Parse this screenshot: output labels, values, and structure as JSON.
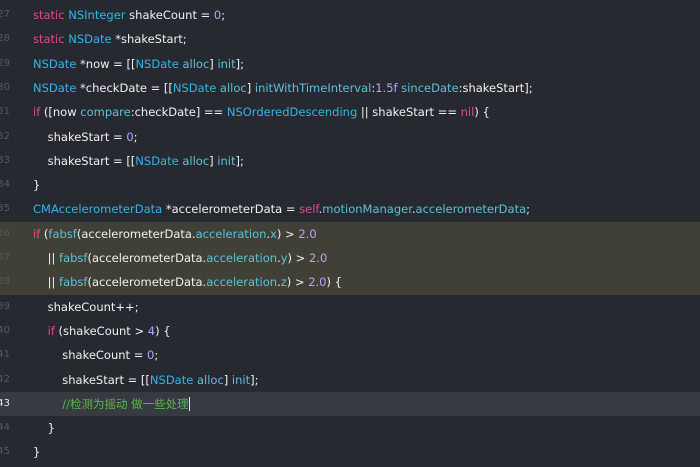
{
  "gutter": [
    "27",
    "28",
    "29",
    "30",
    "31",
    "32",
    "33",
    "34",
    "35",
    "36",
    "37",
    "38",
    "39",
    "40",
    "41",
    "42",
    "43",
    "44",
    "45"
  ],
  "lines": [
    [
      {
        "t": "static",
        "c": "kw"
      },
      {
        "t": " "
      },
      {
        "t": "NSInteger",
        "c": "ty"
      },
      {
        "t": " shakeCount = "
      },
      {
        "t": "0",
        "c": "num"
      },
      {
        "t": ";"
      }
    ],
    [
      {
        "t": "static",
        "c": "kw"
      },
      {
        "t": " "
      },
      {
        "t": "NSDate",
        "c": "ty"
      },
      {
        "t": " *shakeStart;"
      }
    ],
    [
      {
        "t": "NSDate",
        "c": "ty"
      },
      {
        "t": " *now = [["
      },
      {
        "t": "NSDate",
        "c": "ty"
      },
      {
        "t": " "
      },
      {
        "t": "alloc",
        "c": "fn"
      },
      {
        "t": "] "
      },
      {
        "t": "init",
        "c": "fn"
      },
      {
        "t": "];"
      }
    ],
    [
      {
        "t": "NSDate",
        "c": "ty"
      },
      {
        "t": " *checkDate = [["
      },
      {
        "t": "NSDate",
        "c": "ty"
      },
      {
        "t": " "
      },
      {
        "t": "alloc",
        "c": "fn"
      },
      {
        "t": "] "
      },
      {
        "t": "initWithTimeInterval",
        "c": "fn"
      },
      {
        "t": ":"
      },
      {
        "t": "1.5f",
        "c": "num"
      },
      {
        "t": " "
      },
      {
        "t": "sinceDate",
        "c": "fn"
      },
      {
        "t": ":shakeStart];"
      }
    ],
    [
      {
        "t": "if",
        "c": "kw"
      },
      {
        "t": " ([now "
      },
      {
        "t": "compare",
        "c": "fn"
      },
      {
        "t": ":checkDate] == "
      },
      {
        "t": "NSOrderedDescending",
        "c": "ty"
      },
      {
        "t": " || shakeStart == "
      },
      {
        "t": "nil",
        "c": "kw"
      },
      {
        "t": ") {"
      }
    ],
    [
      {
        "t": "    shakeStart = "
      },
      {
        "t": "0",
        "c": "num"
      },
      {
        "t": ";"
      }
    ],
    [
      {
        "t": "    shakeStart = [["
      },
      {
        "t": "NSDate",
        "c": "ty"
      },
      {
        "t": " "
      },
      {
        "t": "alloc",
        "c": "fn"
      },
      {
        "t": "] "
      },
      {
        "t": "init",
        "c": "fn"
      },
      {
        "t": "];"
      }
    ],
    [
      {
        "t": "}"
      }
    ],
    [
      {
        "t": "CMAccelerometerData",
        "c": "ty"
      },
      {
        "t": " *accelerometerData = "
      },
      {
        "t": "self",
        "c": "kw"
      },
      {
        "t": "."
      },
      {
        "t": "motionManager",
        "c": "fn"
      },
      {
        "t": "."
      },
      {
        "t": "accelerometerData",
        "c": "fn"
      },
      {
        "t": ";"
      }
    ],
    [
      {
        "t": "if",
        "c": "kw"
      },
      {
        "t": " ("
      },
      {
        "t": "fabsf",
        "c": "fn"
      },
      {
        "t": "(accelerometerData."
      },
      {
        "t": "acceleration",
        "c": "fn"
      },
      {
        "t": "."
      },
      {
        "t": "x",
        "c": "fn"
      },
      {
        "t": ") > "
      },
      {
        "t": "2.0",
        "c": "num"
      }
    ],
    [
      {
        "t": "    || "
      },
      {
        "t": "fabsf",
        "c": "fn"
      },
      {
        "t": "(accelerometerData."
      },
      {
        "t": "acceleration",
        "c": "fn"
      },
      {
        "t": "."
      },
      {
        "t": "y",
        "c": "fn"
      },
      {
        "t": ") > "
      },
      {
        "t": "2.0",
        "c": "num"
      }
    ],
    [
      {
        "t": "    || "
      },
      {
        "t": "fabsf",
        "c": "fn"
      },
      {
        "t": "(accelerometerData."
      },
      {
        "t": "acceleration",
        "c": "fn"
      },
      {
        "t": "."
      },
      {
        "t": "z",
        "c": "fn"
      },
      {
        "t": ") > "
      },
      {
        "t": "2.0",
        "c": "num"
      },
      {
        "t": ") {"
      }
    ],
    [
      {
        "t": "    shakeCount++;"
      }
    ],
    [
      {
        "t": "    "
      },
      {
        "t": "if",
        "c": "kw"
      },
      {
        "t": " (shakeCount > "
      },
      {
        "t": "4",
        "c": "num"
      },
      {
        "t": ") {"
      }
    ],
    [
      {
        "t": "        shakeCount = "
      },
      {
        "t": "0",
        "c": "num"
      },
      {
        "t": ";"
      }
    ],
    [
      {
        "t": "        shakeStart = [["
      },
      {
        "t": "NSDate",
        "c": "ty"
      },
      {
        "t": " "
      },
      {
        "t": "alloc",
        "c": "fn"
      },
      {
        "t": "] "
      },
      {
        "t": "init",
        "c": "fn"
      },
      {
        "t": "];"
      }
    ],
    [
      {
        "t": "        "
      },
      {
        "t": "//检测为摇动 做一些处理",
        "c": "cm"
      }
    ],
    [
      {
        "t": "    }"
      }
    ],
    [
      {
        "t": "}"
      }
    ]
  ],
  "highlighted_lines": [
    9,
    10,
    11
  ],
  "current_line": 16,
  "colors": {
    "background": "#272930",
    "highlight": "#414037",
    "current_line": "#383a41",
    "keyword": "#e2488f",
    "type": "#33b6e8",
    "method": "#5ec1d8",
    "number": "#b8a5ff",
    "comment": "#5cb64a",
    "text": "#f1f1ef"
  }
}
